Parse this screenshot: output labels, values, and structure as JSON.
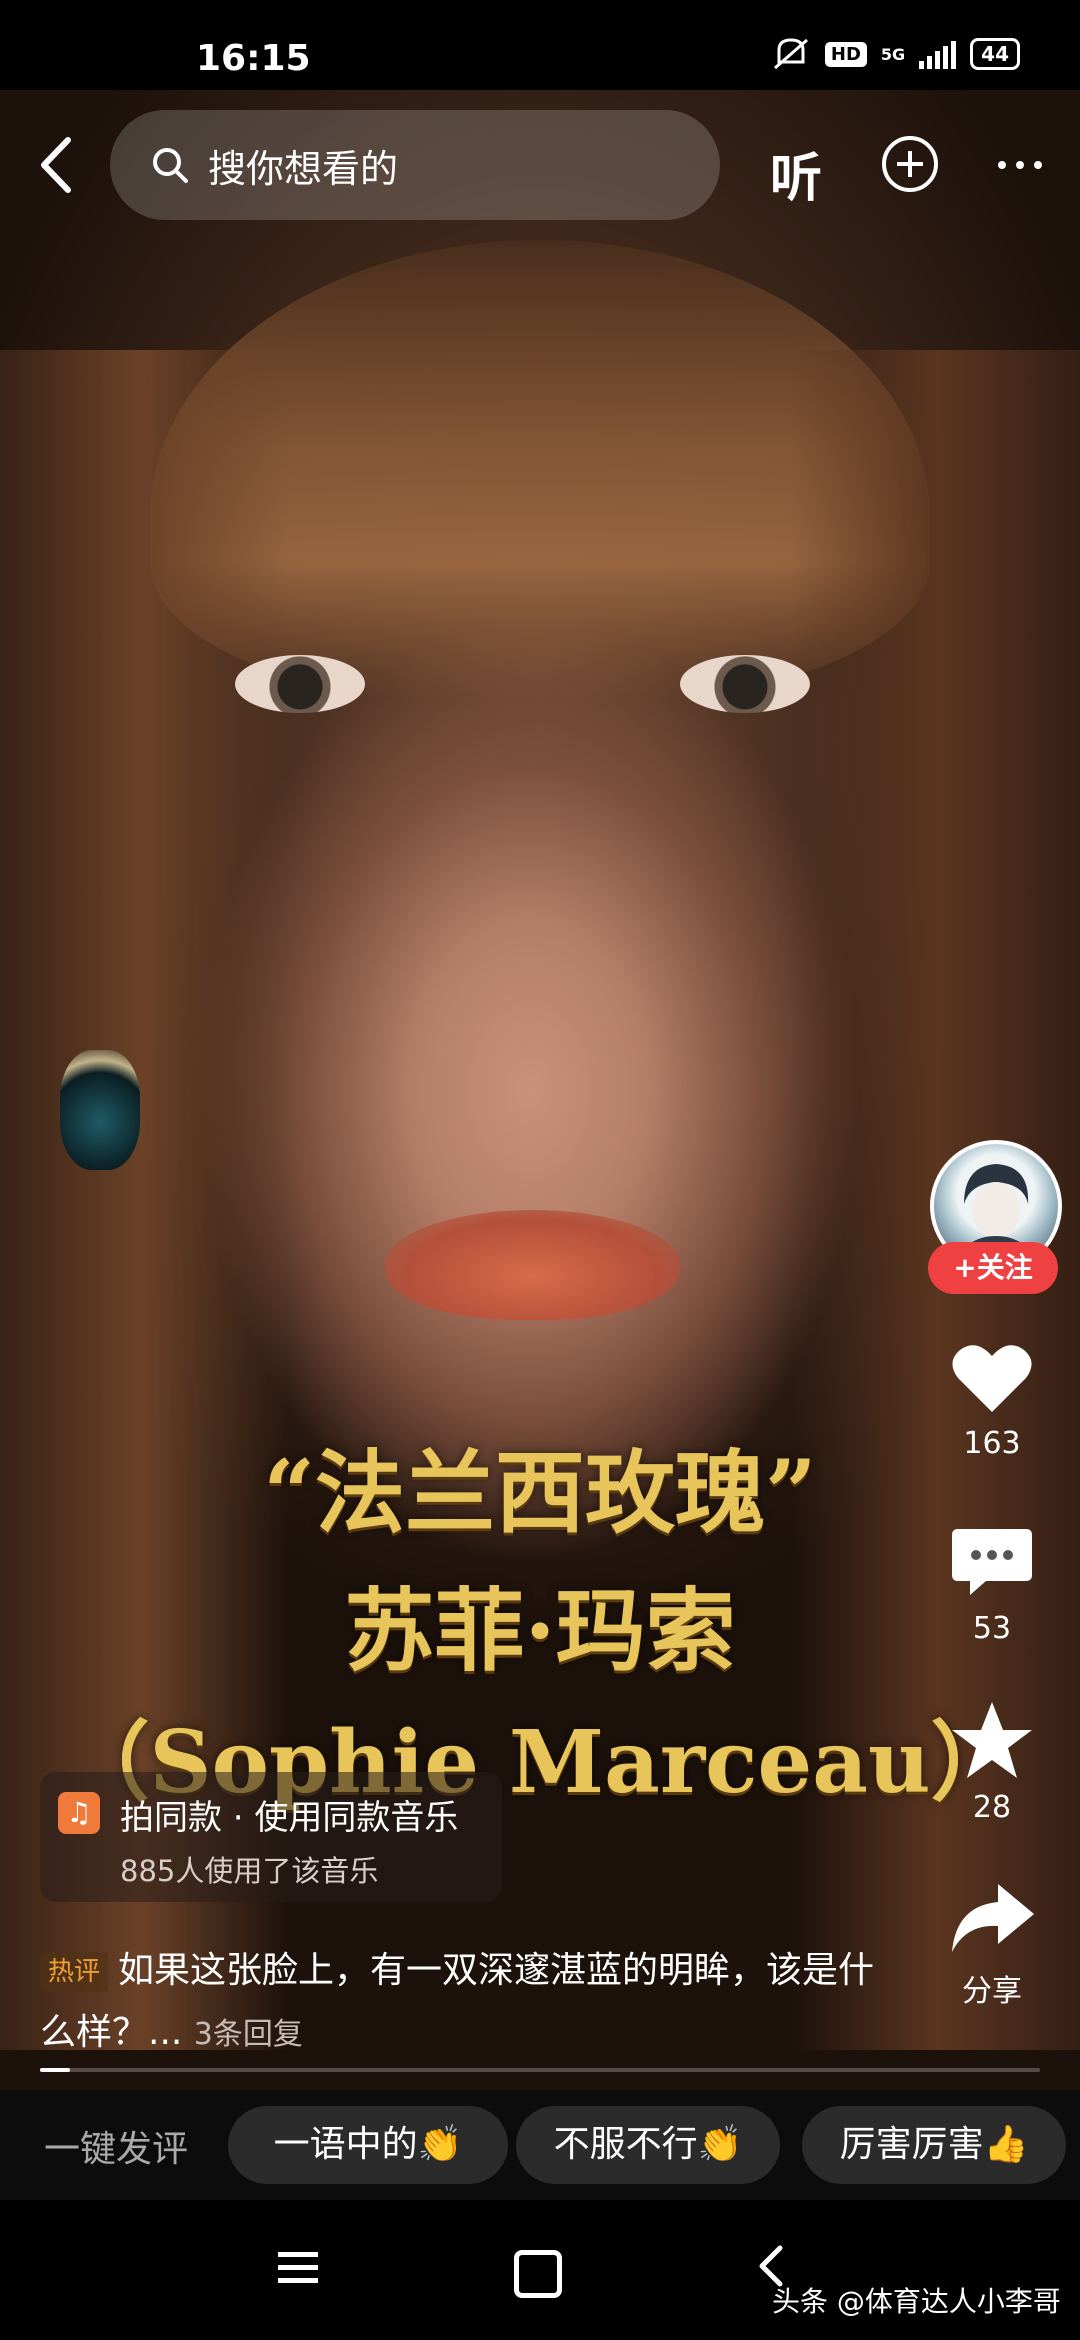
{
  "status_bar": {
    "time": "16:15",
    "hd": "HD",
    "network": "5G",
    "battery": "44"
  },
  "top_bar": {
    "search_placeholder": "搜你想看的",
    "listen_label": "听"
  },
  "video": {
    "title_line1": "“法兰西玫瑰”",
    "title_line2": "苏菲·玛索",
    "title_line3": "（Sophie Marceau）"
  },
  "right_rail": {
    "follow_label": "+关注",
    "likes": "163",
    "comments": "53",
    "favorites": "28",
    "share_label": "分享"
  },
  "music": {
    "line1": "拍同款 · 使用同款音乐",
    "line2": "885人使用了该音乐"
  },
  "hot_comment": {
    "tag": "热评",
    "text": "如果这张脸上，有一双深邃湛蓝的明眸，该是什么样？...",
    "replies": "3条回复"
  },
  "video_progress": 0.03,
  "quick_comment": {
    "label": "一键发评",
    "chips": [
      "一语中的👏",
      "不服不行👏",
      "厉害厉害👍"
    ]
  },
  "watermark": "头条 @体育达人小李哥"
}
